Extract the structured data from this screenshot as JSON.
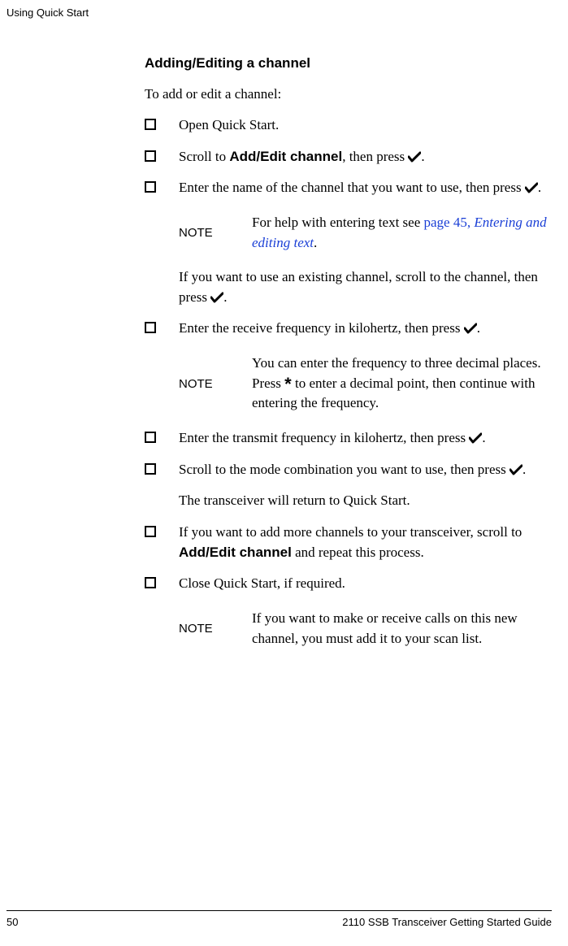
{
  "header": "Using Quick Start",
  "section_title": "Adding/Editing a channel",
  "intro": "To add or edit a channel:",
  "steps": {
    "s1": "Open Quick Start.",
    "s2a": "Scroll to ",
    "s2b": "Add/Edit channel",
    "s2c": ", then press ",
    "s3a": "Enter the name of the channel that you want to use, then press ",
    "s4a": "Enter the receive frequency in kilohertz, then press ",
    "s5a": "Enter the transmit frequency in kilohertz, then press ",
    "s6a": "Scroll to the mode combination you want to use, then press ",
    "s7a": "If you want to add more channels to your transceiver, scroll to ",
    "s7b": "Add/Edit channel",
    "s7c": " and repeat this process.",
    "s8": "Close Quick Start, if required."
  },
  "sub1a": "If you want to use an existing channel, scroll to the channel, then press ",
  "sub2": "The transceiver will return to Quick Start.",
  "notes": {
    "label": "NOTE",
    "n1a": "For help with entering text see ",
    "n1b": "page 45, ",
    "n1c": "Entering and editing text",
    "n2a": "You can enter the frequency to three decimal places. Press ",
    "n2b": " to enter a decimal point, then continue with entering the frequency.",
    "n3": "If you want to make or receive calls on this new channel, you must add it to your scan list."
  },
  "period": ".",
  "star": "*",
  "footer": {
    "page": "50",
    "title": "2110 SSB Transceiver Getting Started Guide"
  }
}
